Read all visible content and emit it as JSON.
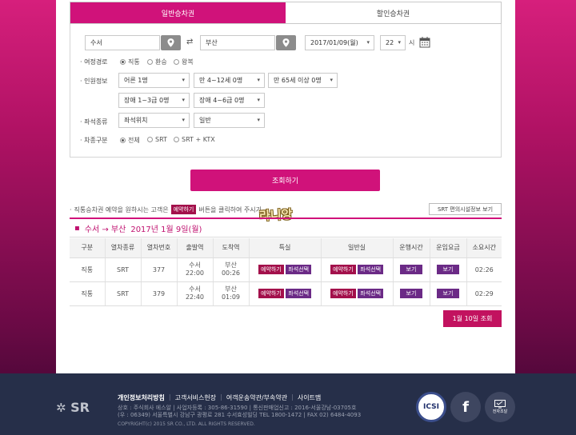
{
  "tabs": {
    "general": "일반승차권",
    "discount": "할인승차권"
  },
  "search": {
    "origin": "수서",
    "destination": "부산",
    "date": "2017/01/09(월)",
    "hour": "22",
    "hour_unit": "시"
  },
  "trip": {
    "label": "여정경로",
    "options": [
      "직통",
      "환승",
      "왕복"
    ],
    "selected": "직통"
  },
  "people": {
    "label": "인원정보",
    "adult": "어른 1명",
    "child": "만 4~12세 0명",
    "senior": "만 65세 이상 0명",
    "disabled13": "장애 1~3급 0명",
    "disabled46": "장애 4~6급 0명"
  },
  "seat": {
    "label": "좌석종류",
    "position": "좌석위치",
    "type": "일반"
  },
  "train": {
    "label": "차종구분",
    "options": [
      "전체",
      "SRT",
      "SRT + KTX"
    ],
    "selected": "전체"
  },
  "search_button": "조회하기",
  "notice": {
    "before": "직통승차권 예약을 원하시는 고객은",
    "button": "예약하기",
    "after": "버튼을 클릭하여 주시기"
  },
  "stamp": "라니앙",
  "guide_button": "SRT 편의시설정보 보기",
  "route": {
    "arrow": "수서 → 부산",
    "date": "2017년 1월 9일(월)"
  },
  "table": {
    "headers": [
      "구분",
      "열차종류",
      "열차번호",
      "출발역",
      "도착역",
      "특실",
      "일반실",
      "운행시간",
      "운임요금",
      "소요시간"
    ],
    "rows": [
      {
        "kind": "직통",
        "type": "SRT",
        "no": "377",
        "dep_station": "수서",
        "dep_time": "22:00",
        "arr_station": "부산",
        "arr_time": "00:26",
        "duration": "02:26"
      },
      {
        "kind": "직통",
        "type": "SRT",
        "no": "379",
        "dep_station": "수서",
        "dep_time": "22:40",
        "arr_station": "부산",
        "arr_time": "01:09",
        "duration": "02:29"
      }
    ],
    "reserve_label": "예약하기",
    "seat_label": "좌석선택",
    "view_label": "보기"
  },
  "next_day_button": "1월 10일 조회",
  "footer": {
    "logo": "SR",
    "links": [
      "개인정보처리방침",
      "고객서비스헌장",
      "여객운송약관/부속약관",
      "사이트맵"
    ],
    "info1": "상호 : 주식회사 에스알 | 사업자등록 : 305-86-31590 | 통신판매업신고 : 2016-서울강남-03705호",
    "info2": "(우 : 06349) 서울특별시 강남구 광평로 281 수서효성빌딩   TEL 1800-1472 | FAX 02) 6484-4093",
    "copyright": "COPYRIGHT(c) 2015 SR CO., LTD. ALL RIGHTS RESERVED.",
    "icsi": "ICSI",
    "facebook": "f",
    "kiosk": "전자조달"
  },
  "colors": {
    "brand": "#d0127a",
    "purple": "#6b2a86",
    "footer": "#262f49"
  }
}
